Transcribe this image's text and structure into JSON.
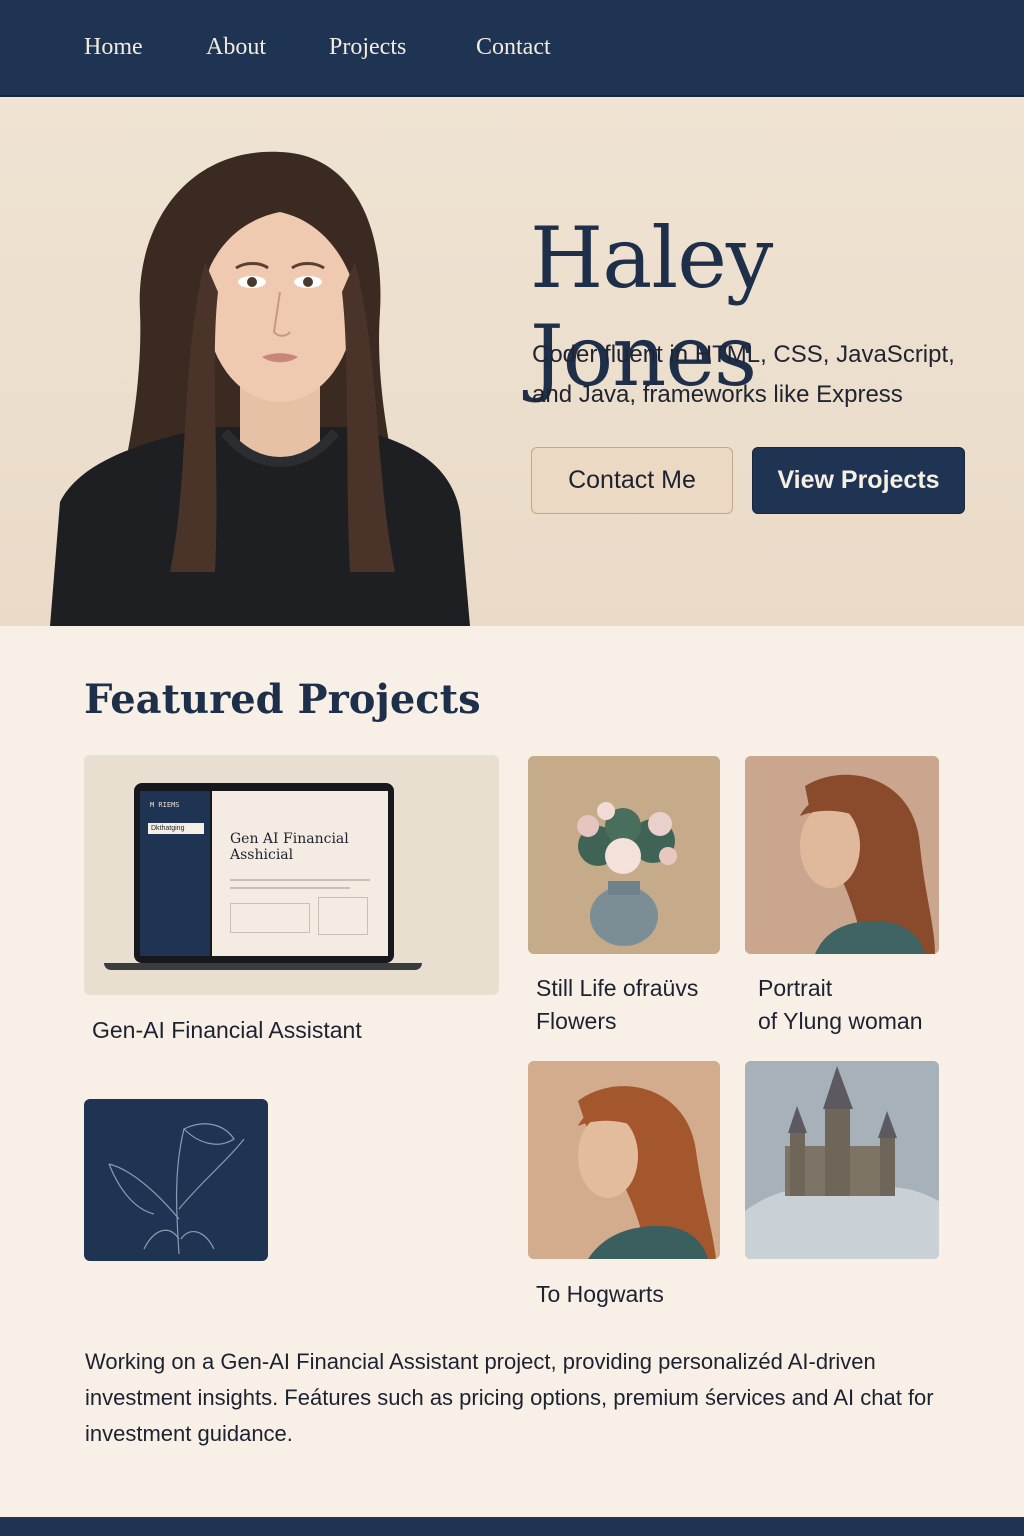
{
  "nav": {
    "items": [
      "Home",
      "About",
      "Projects",
      "Contact"
    ]
  },
  "hero": {
    "name": "Haley Jones",
    "tagline_line1": "Coder fluent in HTML, CSS, JavaScript,",
    "tagline_line2": "and Java, frameworks like Express",
    "contact_button": "Contact Me",
    "projects_button": "View Projects"
  },
  "featured": {
    "title": "Featured Projects",
    "laptop_screen": {
      "brand": "M RIEMS",
      "menu_item": "Dkthatging",
      "heading_line1": "Gen AI Financial",
      "heading_line2": "Asshicial"
    },
    "projects": [
      {
        "caption": "Gen-AI Financial Assistant"
      },
      {
        "caption_line1": "Still Life ofraüvs",
        "caption_line2": "Flowers"
      },
      {
        "caption_line1": "Portrait",
        "caption_line2": "of Ylung woman"
      },
      {
        "caption": "To Hogwarts"
      }
    ],
    "description": "Working on a Gen-AI Financial Assistant project, providing personalizéd AI-driven investment insights. Feátures such as pricing options, premium śervices and AI chat for investment guidance."
  },
  "colors": {
    "navy": "#1f3452",
    "cream": "#f8f0e7",
    "beige": "#ecd9c3"
  }
}
